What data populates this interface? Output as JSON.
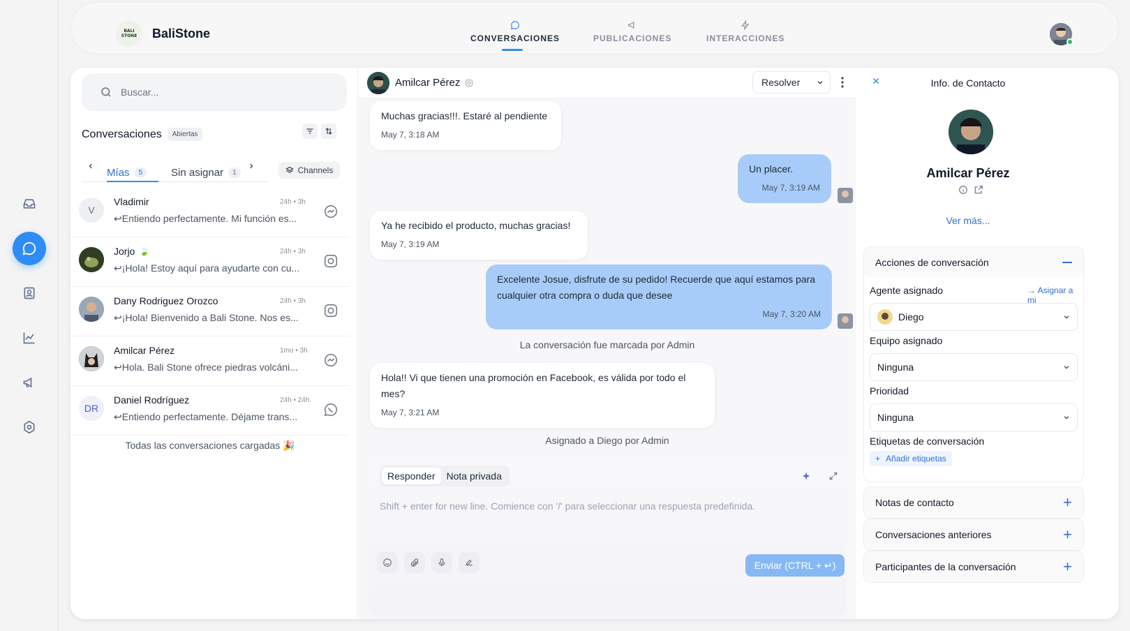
{
  "brand": {
    "name": "BaliStone",
    "logo_text": [
      "BALI",
      "STONE"
    ]
  },
  "nav_tabs": [
    {
      "label": "CONVERSACIONES",
      "active": true,
      "icon": "chat-bubble-icon"
    },
    {
      "label": "PUBLICACIONES",
      "active": false,
      "icon": "megaphone-icon"
    },
    {
      "label": "INTERACCIONES",
      "active": false,
      "icon": "bolt-icon"
    }
  ],
  "rail": [
    "inbox-icon",
    "chat-icon",
    "contacts-icon",
    "reports-icon",
    "campaigns-icon",
    "settings-icon"
  ],
  "search": {
    "placeholder": "Buscar..."
  },
  "conversations": {
    "title": "Conversaciones",
    "status_chip": "Abiertas",
    "subtabs": [
      {
        "label": "Mías",
        "count": "5"
      },
      {
        "label": "Sin asignar",
        "count": "1"
      }
    ],
    "channels_label": "Channels",
    "items": [
      {
        "name": "Vladimir",
        "initial": "V",
        "time": "24h • 3h",
        "preview": "Entiendo perfectamente. Mi función es...",
        "channel": "messenger-icon"
      },
      {
        "name": "Jorjo",
        "time": "24h • 3h",
        "preview": "¡Hola! Estoy aquí para ayudarte con cu...",
        "channel": "instagram-icon"
      },
      {
        "name": "Dany Rodriguez Orozco",
        "time": "24h • 3h",
        "preview": "¡Hola! Bienvenido a Bali Stone. Nos es...",
        "channel": "instagram-icon"
      },
      {
        "name": "Amilcar Pérez",
        "time": "1mo • 3h",
        "preview": "Hola. Bali Stone ofrece piedras volcáni...",
        "channel": "messenger-icon"
      },
      {
        "name": "Daniel Rodríguez",
        "initial": "DR",
        "time": "24h • 24h",
        "preview": "Entiendo perfectamente. Déjame trans...",
        "channel": "whatsapp-icon"
      }
    ],
    "footer": "Todas las conversaciones cargadas 🎉"
  },
  "chat": {
    "contact_name": "Amilcar Pérez",
    "resolve_label": "Resolver",
    "messages": [
      {
        "dir": "in",
        "text": "Muchas gracias!!!. Estaré al pendiente",
        "time": "May 7, 3:18 AM"
      },
      {
        "dir": "out",
        "text": "Un placer.",
        "time": "May 7, 3:19 AM"
      },
      {
        "dir": "in",
        "text": "Ya he recibido el producto, muchas gracias!",
        "time": "May 7, 3:19 AM"
      },
      {
        "dir": "out",
        "text": "Excelente Josue, disfrute de su pedido! Recuerde que aquí estamos para cualquier otra compra o duda que desee",
        "time": "May 7, 3:20 AM"
      },
      {
        "dir": "in",
        "text": "Hola!! Vi que tienen una promoción en Facebook, es válida por todo el mes?",
        "time": "May 7, 3:21 AM"
      }
    ],
    "system_1": "La conversación fue marcada por Admin",
    "system_2": "Asignado a Diego por Admin",
    "composer": {
      "tab_reply": "Responder",
      "tab_note": "Nota privada",
      "placeholder": "Shift + enter for new line. Comience con '/' para seleccionar una respuesta predefinida.",
      "send_label": "Enviar (CTRL + ↵)"
    }
  },
  "contact_info": {
    "title": "Info. de Contacto",
    "name": "Amilcar Pérez",
    "see_more": "Ver más...",
    "actions_title": "Acciones de conversación",
    "agent_label": "Agente asignado",
    "assign_me": "Asignar a mi",
    "agent_value": "Diego",
    "team_label": "Equipo asignado",
    "team_value": "Ninguna",
    "priority_label": "Prioridad",
    "priority_value": "Ninguna",
    "tags_label": "Etiquetas de conversación",
    "add_tags": "Añadir etiquetas",
    "sections": [
      "Notas de contacto",
      "Conversaciones anteriores",
      "Participantes de la conversación"
    ]
  },
  "colors": {
    "accent": "#2f8cf6",
    "outgoing_bubble": "#a8ccf9",
    "presence": "#22c55e"
  }
}
